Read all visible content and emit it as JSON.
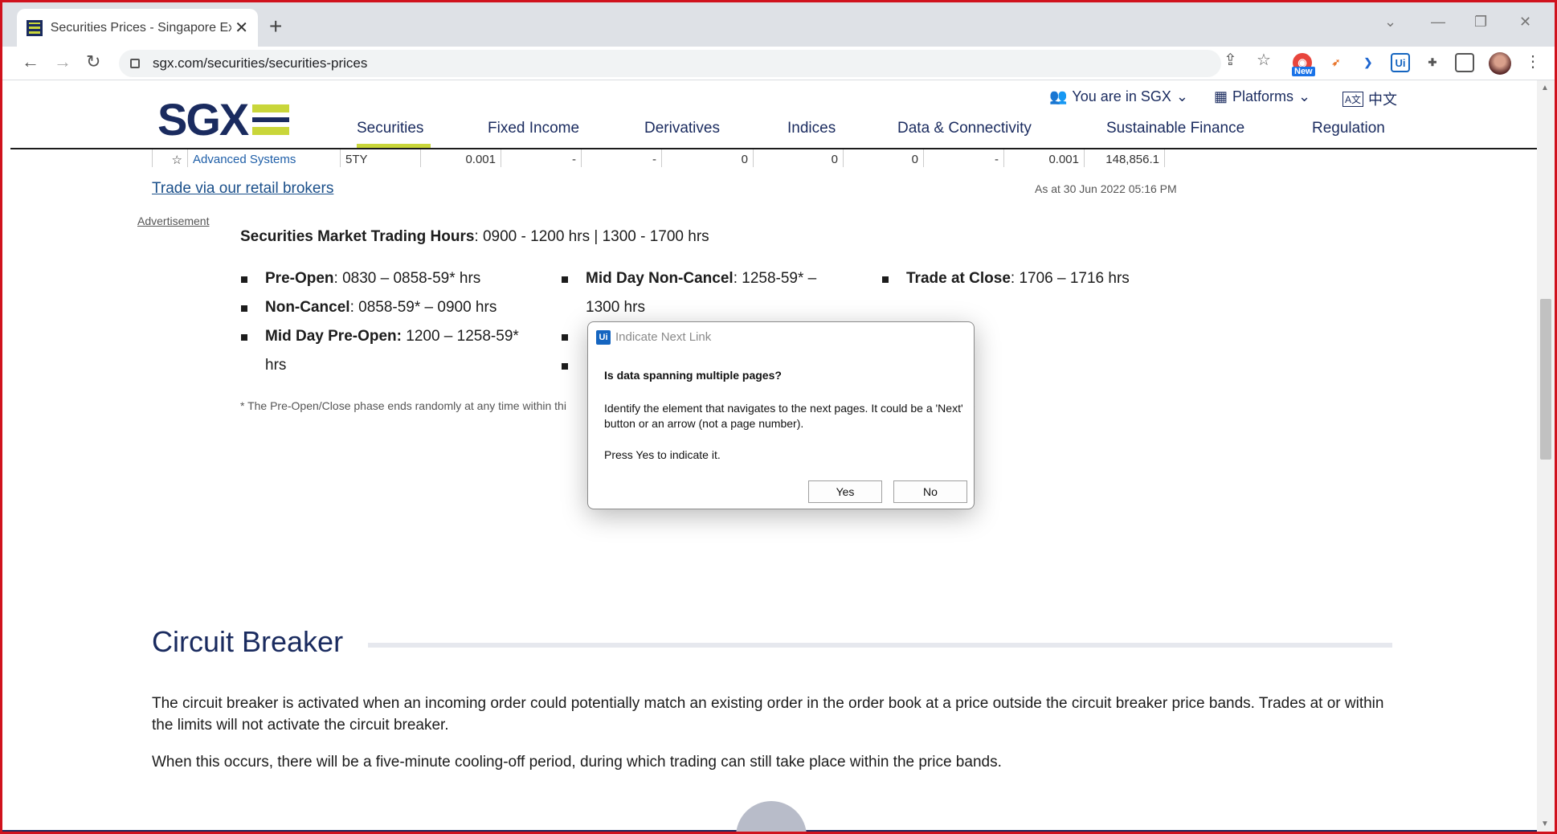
{
  "browser": {
    "tab_title": "Securities Prices - Singapore Exch",
    "url": "sgx.com/securities/securities-prices",
    "new_badge": "New",
    "ext_uipath": "Ui"
  },
  "header": {
    "logo_text": "SGX",
    "you_are_in": "You are in SGX",
    "platforms": "Platforms",
    "language": "中文",
    "nav": [
      "Securities",
      "Fixed Income",
      "Derivatives",
      "Indices",
      "Data & Connectivity",
      "Sustainable Finance",
      "Regulation"
    ]
  },
  "table_row": {
    "name": "Advanced Systems",
    "code": "5TY",
    "last": "0.001",
    "c1": "-",
    "c2": "-",
    "c3": "0",
    "c4": "0",
    "c5": "0",
    "c6": "-",
    "c7": "0.001",
    "c8": "148,856.1"
  },
  "content": {
    "trade_link": "Trade via our retail brokers",
    "as_at": "As at 30 Jun 2022 05:16 PM",
    "advertisement": "Advertisement",
    "hours_label": "Securities Market Trading Hours",
    "hours_value": ": 0900 - 1200 hrs | 1300 - 1700 hrs",
    "phases": {
      "pre_open_label": "Pre-Open",
      "pre_open_value": ": 0830 – 0858-59* hrs",
      "non_cancel_label": "Non-Cancel",
      "non_cancel_value": ": 0858-59* – 0900 hrs",
      "mid_pre_open_label": "Mid Day Pre-Open:",
      "mid_pre_open_value": " 1200 – 1258-59*",
      "mid_pre_open_cont": "hrs",
      "mid_non_cancel_label": "Mid Day Non-Cancel",
      "mid_non_cancel_value": ": 1258-59* –",
      "mid_non_cancel_cont": "1300 hrs",
      "trade_close_label": "Trade at Close",
      "trade_close_value": ": 1706 – 1716 hrs"
    },
    "footnote": "* The Pre-Open/Close phase ends randomly at any time within thi",
    "footnote_tail": "-",
    "cb_title": "Circuit Breaker",
    "cb_p1": "The circuit breaker is activated when an incoming order could potentially match an existing order in the order book at a price outside the circuit breaker price bands. Trades at or within the limits will not activate the circuit breaker.",
    "cb_p2": "When this occurs, there will be a five-minute cooling-off period, during which trading can still take place within the price bands."
  },
  "dialog": {
    "icon_text": "Ui",
    "title": "Indicate Next Link",
    "question": "Is data spanning multiple pages?",
    "body": "Identify the element that navigates to the next pages. It could be a 'Next' button or an arrow (not a page number).",
    "press": "Press Yes to indicate it.",
    "yes": "Yes",
    "no": "No"
  },
  "colors": {
    "brand_navy": "#1a2b5f",
    "brand_lime": "#c9d63a",
    "window_border": "#d0121d",
    "link_blue": "#1a4f8a"
  }
}
